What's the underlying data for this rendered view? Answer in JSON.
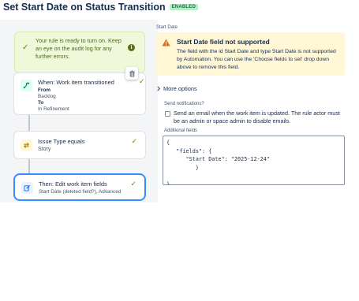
{
  "header": {
    "title": "Set Start Date on Status Transition",
    "status_badge": "ENABLED"
  },
  "canvas": {
    "ready_banner": {
      "text": "Your rule is ready to turn on. Keep an eye on the audit log for any further errors.",
      "check_icon": "check-icon",
      "info_icon": "info-icon"
    },
    "trigger": {
      "icon": "transition-icon",
      "title": "When: Work item transitioned",
      "from_label": "From",
      "from_value": "Backlog",
      "to_label": "To",
      "to_value": "In Refinement"
    },
    "condition": {
      "icon": "swap-icon",
      "title": "Issue Type equals",
      "value": "Story"
    },
    "action": {
      "icon": "edit-icon",
      "title": "Then: Edit work item fields",
      "summary": "Start Date (deleted field?), Advanced"
    },
    "delete_icon": "trash-icon"
  },
  "panel": {
    "field_heading": "Start Date",
    "warning": {
      "icon": "warning-icon",
      "title": "Start Date field not supported",
      "body": "The field with the id Start Date and type Start Date is not supported by Automation. You can use the 'Choose fields to set' drop down above to remove this field."
    },
    "more_options_label": "More options",
    "notifications_heading": "Send notifications?",
    "notify_checkbox": {
      "checked": false,
      "label": "Send an email when the work item is updated. The rule actor must be an admin or space admin to disable emails."
    },
    "additional_fields_heading": "Additional fields",
    "additional_fields_json": "{\n   \"fields\": {\n      \"Start Date\": \"2025-12-24\"\n         }\n\n}"
  },
  "colors": {
    "accent": "#388bff",
    "success": "#5e8a00",
    "warning_bg": "#fff7d6",
    "enabled_badge": "#b3f0c4"
  }
}
